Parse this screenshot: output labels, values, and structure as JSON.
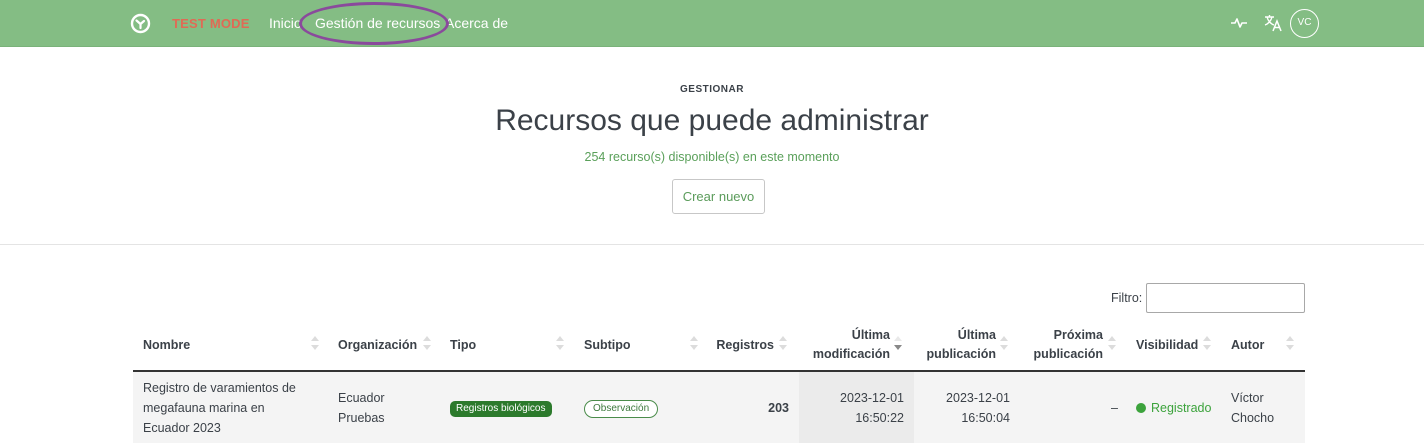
{
  "navbar": {
    "test_mode": "TEST MODE",
    "links": [
      "Inicio",
      "Gestión de recursos",
      "Acerca de"
    ],
    "user_initials": "VC",
    "icons": [
      "logo-icon",
      "pulse-icon",
      "translate-icon"
    ]
  },
  "header": {
    "eyebrow": "GESTIONAR",
    "title": "Recursos que puede administrar",
    "subtitle": "254 recurso(s) disponible(s) en este momento",
    "create_button": "Crear nuevo"
  },
  "filter": {
    "label": "Filtro:",
    "value": ""
  },
  "table": {
    "columns": {
      "nombre": "Nombre",
      "organizacion": "Organización",
      "tipo": "Tipo",
      "subtipo": "Subtipo",
      "registros": "Registros",
      "ultima_mod_1": "Última",
      "ultima_mod_2": "modificación",
      "ultima_pub_1": "Última",
      "ultima_pub_2": "publicación",
      "proxima_pub_1": "Próxima",
      "proxima_pub_2": "publicación",
      "visibilidad": "Visibilidad",
      "autor": "Autor"
    },
    "rows": [
      {
        "nombre_1": "Registro de varamientos de",
        "nombre_2": "megafauna marina en",
        "nombre_3": "Ecuador 2023",
        "organizacion_1": "Ecuador",
        "organizacion_2": "Pruebas",
        "tipo": "Registros biológicos",
        "subtipo": "Observación",
        "registros": "203",
        "ultima_mod_date": "2023-12-01",
        "ultima_mod_time": "16:50:22",
        "ultima_pub_date": "2023-12-01",
        "ultima_pub_time": "16:50:04",
        "proxima_pub": "–",
        "visibilidad": "Registrado",
        "autor_1": "Víctor",
        "autor_2": "Chocho"
      }
    ]
  },
  "colors": {
    "navbar": "#84bd84",
    "test_mode": "#e06a55",
    "accent_green": "#3ca33c",
    "badge_dark_green": "#2c7a2c",
    "highlight": "#8a4a9c"
  }
}
